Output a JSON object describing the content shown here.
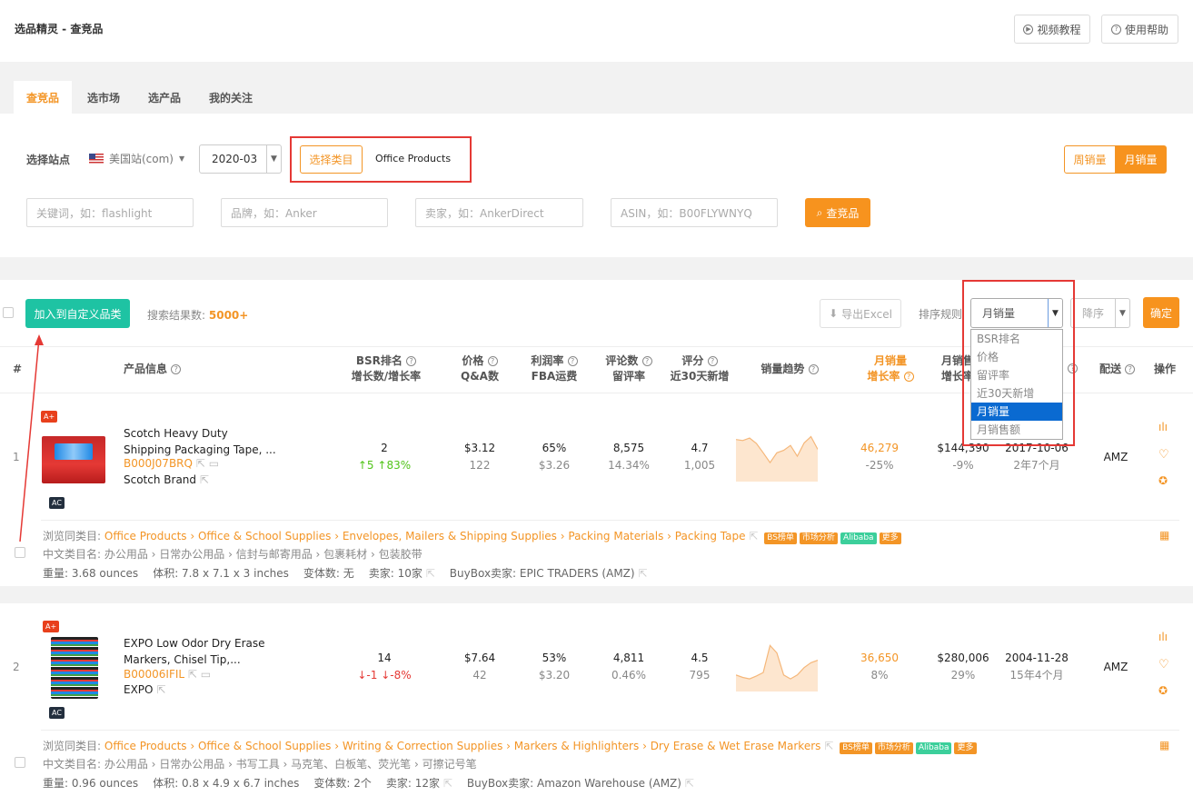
{
  "header": {
    "title": "选品精灵 - 查竞品",
    "video_btn": "视频教程",
    "help_btn": "使用帮助"
  },
  "tabs": [
    "查竞品",
    "选市场",
    "选产品",
    "我的关注"
  ],
  "filters": {
    "site_label": "选择站点",
    "site_value": "美国站(com)",
    "month_value": "2020-03",
    "category_btn": "选择类目",
    "category_value": "Office Products",
    "weekly_btn": "周销量",
    "monthly_btn": "月销量",
    "keyword_placeholder": "关键词，如：flashlight",
    "brand_placeholder": "品牌，如：Anker",
    "seller_placeholder": "卖家，如：AnkerDirect",
    "asin_placeholder": "ASIN，如：B00FLYWNYQ",
    "search_btn": "查竞品"
  },
  "toolbar": {
    "add_btn": "加入到自定义品类",
    "result_label": "搜索结果数:",
    "result_count": "5000+",
    "export_btn": "导出Excel",
    "sort_label": "排序规则",
    "sort_value": "月销量",
    "order_value": "降序",
    "confirm_btn": "确定"
  },
  "sort_options": [
    "BSR排名",
    "价格",
    "留评率",
    "近30天新增",
    "月销量",
    "月销售额"
  ],
  "columns": {
    "index": "#",
    "product": "产品信息",
    "bsr": "BSR排名",
    "bsr_sub": "增长数/增长率",
    "price": "价格",
    "price_sub": "Q&A数",
    "margin": "利润率",
    "margin_sub": "FBA运费",
    "reviews": "评论数",
    "reviews_sub": "留评率",
    "rating": "评分",
    "rating_sub": "近30天新增",
    "trend": "销量趋势",
    "monthly": "月销量",
    "monthly_sub": "增长率",
    "revenue": "月销售",
    "revenue_sub": "增长率",
    "shipping": "配送",
    "ops": "操作"
  },
  "products": [
    {
      "index": "1",
      "title1": "Scotch Heavy Duty",
      "title2": "Shipping Packaging Tape, ...",
      "asin": "B000J07BRQ",
      "brand": "Scotch Brand",
      "bsr": "2",
      "bsr_change1": "↑5",
      "bsr_change2": "↑83%",
      "price": "$3.12",
      "qa": "122",
      "margin": "65%",
      "fba": "$3.26",
      "reviews": "8,575",
      "review_rate": "14.34%",
      "rating": "4.7",
      "new30": "1,005",
      "monthly": "46,279",
      "monthly_growth": "-25%",
      "revenue": "$144,390",
      "revenue_growth": "-9%",
      "date": "2017-10-06",
      "age": "2年7个月",
      "ship": "AMZ",
      "cat_label": "浏览同类目:",
      "cats": [
        "Office Products",
        "Office & School Supplies",
        "Envelopes, Mailers & Shipping Supplies",
        "Packing Materials",
        "Packing Tape"
      ],
      "cn_cat": "中文类目名: 办公用品 › 日常办公用品 › 信封与邮寄用品 › 包裹耗材 › 包装胶带",
      "weight": "重量: 3.68 ounces",
      "size": "体积: 7.8 x 7.1 x 3 inches",
      "variants": "变体数: 无",
      "sellers": "卖家: 10家",
      "buybox": "BuyBox卖家:  EPIC TRADERS  (AMZ)",
      "trend": [
        0.82,
        0.8,
        0.85,
        0.74,
        0.55,
        0.35,
        0.55,
        0.6,
        0.7,
        0.48,
        0.75,
        0.88,
        0.62
      ]
    },
    {
      "index": "2",
      "title1": "EXPO Low Odor Dry Erase",
      "title2": "Markers, Chisel Tip,...",
      "asin": "B00006IFIL",
      "brand": "EXPO",
      "bsr": "14",
      "bsr_change1": "↓-1",
      "bsr_change2": "↓-8%",
      "price": "$7.64",
      "qa": "42",
      "margin": "53%",
      "fba": "$3.20",
      "reviews": "4,811",
      "review_rate": "0.46%",
      "rating": "4.5",
      "new30": "795",
      "monthly": "36,650",
      "monthly_growth": "8%",
      "revenue": "$280,006",
      "revenue_growth": "29%",
      "date": "2004-11-28",
      "age": "15年4个月",
      "ship": "AMZ",
      "cat_label": "浏览同类目:",
      "cats": [
        "Office Products",
        "Office & School Supplies",
        "Writing & Correction Supplies",
        "Markers & Highlighters",
        "Dry Erase & Wet Erase Markers"
      ],
      "cn_cat": "中文类目名: 办公用品 › 日常办公用品 › 书写工具 › 马克笔、白板笔、荧光笔 › 可擦记号笔",
      "weight": "重量: 0.96 ounces",
      "size": "体积: 0.8 x 4.9 x 6.7 inches",
      "variants": "变体数: 2个",
      "sellers": "卖家: 12家",
      "buybox": "BuyBox卖家:  Amazon Warehouse  (AMZ)",
      "trend": [
        0.3,
        0.25,
        0.22,
        0.28,
        0.35,
        0.9,
        0.75,
        0.3,
        0.22,
        0.3,
        0.45,
        0.55,
        0.6
      ]
    }
  ],
  "tags": {
    "bs": "BS榜单",
    "market": "市场分析",
    "alibaba": "Alibaba",
    "more": "更多",
    "aplus": "A+",
    "ac": "AC"
  }
}
